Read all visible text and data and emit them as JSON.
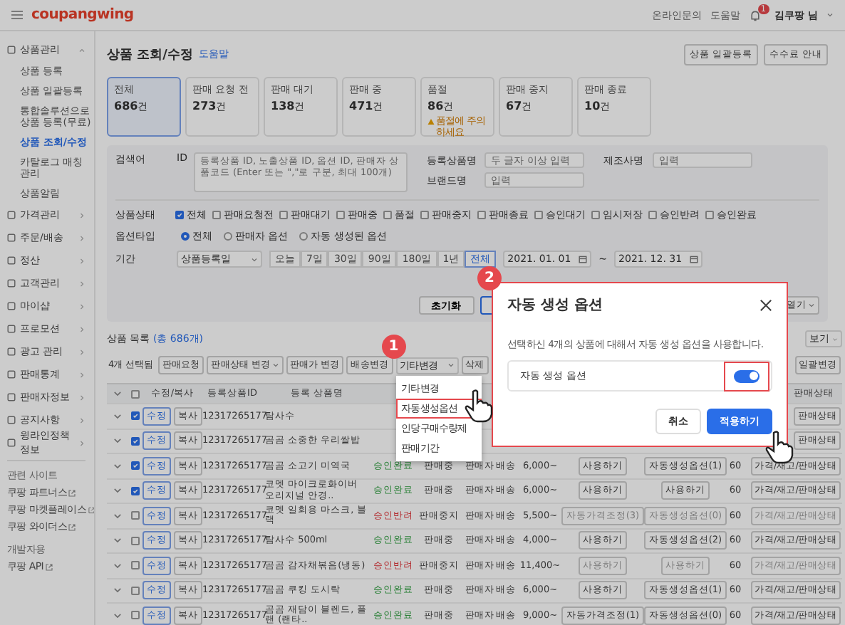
{
  "topbar": {
    "logo": "coupangwing",
    "links": [
      "온라인문의",
      "도움말"
    ],
    "notification_count": "1",
    "user": "김쿠팡 님"
  },
  "sidebar": {
    "groups": [
      {
        "label": "상품관리",
        "expanded": true,
        "children": [
          {
            "label": "상품 등록",
            "selected": false
          },
          {
            "label": "상품 일괄등록",
            "selected": false
          },
          {
            "label": "통합솔루션으로 상품 등록(무료)",
            "selected": false
          },
          {
            "label": "상품 조회/수정",
            "selected": true
          },
          {
            "label": "카탈로그 매칭관리",
            "selected": false
          },
          {
            "label": "상품알림",
            "selected": false
          }
        ]
      },
      {
        "label": "가격관리",
        "expanded": false
      },
      {
        "label": "주문/배송",
        "expanded": false
      },
      {
        "label": "정산",
        "expanded": false
      },
      {
        "label": "고객관리",
        "expanded": false
      },
      {
        "label": "마이샵",
        "expanded": false
      },
      {
        "label": "프로모션",
        "expanded": false
      },
      {
        "label": "광고 관리",
        "expanded": false
      },
      {
        "label": "판매통계",
        "expanded": false
      },
      {
        "label": "판매자정보",
        "expanded": false
      },
      {
        "label": "공지사항",
        "expanded": false
      },
      {
        "label": "윙라인정책정보",
        "expanded": false
      }
    ],
    "related_title": "관련 사이트",
    "related": [
      "쿠팡 파트너스",
      "쿠팡 마켓플레이스",
      "쿠팡 와이더스"
    ],
    "dev_title": "개발자용",
    "dev": [
      "쿠팡 API"
    ]
  },
  "page": {
    "title": "상품 조회/수정",
    "help": "도움말",
    "actions": [
      "상품 일괄등록",
      "수수료 안내"
    ]
  },
  "stats": [
    {
      "label": "전체",
      "value": "686",
      "unit": "건",
      "selected": true
    },
    {
      "label": "판매 요청 전",
      "value": "273",
      "unit": "건",
      "selected": false
    },
    {
      "label": "판매 대기",
      "value": "138",
      "unit": "건",
      "selected": false
    },
    {
      "label": "판매 중",
      "value": "471",
      "unit": "건",
      "selected": false
    },
    {
      "label": "품절",
      "value": "86",
      "unit": "건",
      "selected": false,
      "warning": "품절에 주의하세요"
    },
    {
      "label": "판매 중지",
      "value": "67",
      "unit": "건",
      "selected": false
    },
    {
      "label": "판매 종료",
      "value": "10",
      "unit": "건",
      "selected": false
    }
  ],
  "filters": {
    "keyword_label": "검색어",
    "id_label": "ID",
    "id_placeholder": "등록상품 ID, 노출상품 ID, 옵션 ID, 판매자 상품코드 (Enter 또는 \",\"로 구분, 최대 100개)",
    "name_label": "등록상품명",
    "name_placeholder": "두 글자 이상 입력",
    "maker_label": "제조사명",
    "maker_placeholder": "입력",
    "brand_label": "브랜드명",
    "brand_placeholder": "입력",
    "status_label": "상품상태",
    "statuses": [
      {
        "label": "전체",
        "checked": true
      },
      {
        "label": "판매요청전",
        "checked": false
      },
      {
        "label": "판매대기",
        "checked": false
      },
      {
        "label": "판매중",
        "checked": false
      },
      {
        "label": "품절",
        "checked": false
      },
      {
        "label": "판매중지",
        "checked": false
      },
      {
        "label": "판매종료",
        "checked": false
      },
      {
        "label": "승인대기",
        "checked": false
      },
      {
        "label": "임시저장",
        "checked": false
      },
      {
        "label": "승인반려",
        "checked": false
      },
      {
        "label": "승인완료",
        "checked": false
      }
    ],
    "option_label": "옵션타입",
    "options": [
      {
        "label": "전체",
        "selected": true
      },
      {
        "label": "판매자 옵션",
        "selected": false
      },
      {
        "label": "자동 생성된 옵션",
        "selected": false
      }
    ],
    "period_label": "기간",
    "period_type": "상품등록일",
    "periods": [
      {
        "label": "오늘",
        "selected": false
      },
      {
        "label": "7일",
        "selected": false
      },
      {
        "label": "30일",
        "selected": false
      },
      {
        "label": "90일",
        "selected": false
      },
      {
        "label": "180일",
        "selected": false
      },
      {
        "label": "1년",
        "selected": false
      },
      {
        "label": "전체",
        "selected": true
      }
    ],
    "date_from": "2021. 01. 01",
    "date_separator": "~",
    "date_to": "2021. 12. 31",
    "reset": "초기화",
    "more": "열기"
  },
  "list": {
    "title": "상품 목록",
    "count": "(총 686개)",
    "page_size": "보기",
    "selected_count": "4개 선택됨",
    "tools": [
      "판매요청",
      "판매상태 변경",
      "판매가 변경",
      "배송변경",
      "기타변경",
      "삭제"
    ],
    "bulk": "일괄변경"
  },
  "menu": {
    "items": [
      {
        "label": "기타변경",
        "highlighted": false
      },
      {
        "label": "자동생성옵션",
        "highlighted": true
      },
      {
        "label": "인당구매수량제",
        "highlighted": false
      },
      {
        "label": "판매기간",
        "highlighted": false
      }
    ]
  },
  "table": {
    "all_checked": false,
    "columns_left": [
      "수정/복사",
      "등록상품ID",
      "등록 상품명"
    ],
    "column_right": "판매상태",
    "rows": [
      {
        "checked": true,
        "edit": "수정",
        "copy": "복사",
        "id": "12317265177",
        "name": "탐사수",
        "stock_btn": "판매상태",
        "disabled": false
      },
      {
        "checked": true,
        "edit": "수정",
        "copy": "복사",
        "id": "12317265177",
        "name": "곰곰 소중한 우리쌀밥",
        "stock_btn": "판매상태",
        "disabled": false
      },
      {
        "checked": true,
        "edit": "수정",
        "copy": "복사",
        "id": "12317265177",
        "name": "곰곰 소고기 미역국",
        "approval": "승인완료",
        "approved": true,
        "sale": "판매중",
        "delivery": "판매자 배송",
        "fee": "6,000~",
        "price_btn": "사용하기",
        "option_btn": "자동생성옵션(1)",
        "limit": "60",
        "stock_btn": "가격/재고/판매상태",
        "disabled": false
      },
      {
        "checked": true,
        "edit": "수정",
        "copy": "복사",
        "id": "12317265177",
        "name": "코멧 마이크로화이버 오리지널 안경..",
        "approval": "승인완료",
        "approved": true,
        "sale": "판매중",
        "delivery": "판매자 배송",
        "fee": "6,000~",
        "price_btn": "사용하기",
        "option_btn": "사용하기",
        "limit": "60",
        "stock_btn": "가격/재고/판매상태",
        "disabled": false
      },
      {
        "checked": false,
        "edit": "수정",
        "copy": "복사",
        "id": "12317265177",
        "name": "코멧 일회용 마스크, 블랙",
        "approval": "승인반려",
        "approved": false,
        "sale": "판매중지",
        "delivery": "판매자 배송",
        "fee": "5,500~",
        "price_btn": "자동가격조정(3)",
        "option_btn": "자동생성옵션(0)",
        "limit": "60",
        "stock_btn": "가격/재고/판매상태",
        "disabled": true
      },
      {
        "checked": false,
        "edit": "수정",
        "copy": "복사",
        "id": "12317265177",
        "name": "탐사수 500ml",
        "approval": "승인완료",
        "approved": true,
        "sale": "판매중",
        "delivery": "판매자 배송",
        "fee": "4,000~",
        "price_btn": "사용하기",
        "option_btn": "자동생성옵션(2)",
        "limit": "60",
        "stock_btn": "가격/재고/판매상태",
        "disabled": false
      },
      {
        "checked": false,
        "edit": "수정",
        "copy": "복사",
        "id": "12317265177",
        "name": "곰곰 감자채볶음(냉동)",
        "approval": "승인반려",
        "approved": false,
        "sale": "판매중지",
        "delivery": "판매자 배송",
        "fee": "11,400~",
        "price_btn": "사용하기",
        "option_btn": "사용하기",
        "limit": "60",
        "stock_btn": "가격/재고/판매상태",
        "disabled": true
      },
      {
        "checked": false,
        "edit": "수정",
        "copy": "복사",
        "id": "12317265177",
        "name": "곰곰 쿠킹 도시락",
        "approval": "승인완료",
        "approved": true,
        "sale": "판매중",
        "delivery": "판매자 배송",
        "fee": "6,000~",
        "price_btn": "사용하기",
        "option_btn": "자동생성옵션(1)",
        "limit": "60",
        "stock_btn": "가격/재고/판매상태",
        "disabled": false
      },
      {
        "checked": false,
        "edit": "수정",
        "copy": "복사",
        "id": "12317265177",
        "name": "곰곰 재담이 블렌드, 플랜 (랜타..",
        "approval": "승인완료",
        "approved": true,
        "sale": "판매중",
        "delivery": "판매자 배송",
        "fee": "9,000~",
        "price_btn": "자동가격조정(1)",
        "option_btn": "자동생성옵션(0)",
        "limit": "60",
        "stock_btn": "가격/재고/판매상태",
        "disabled": false
      }
    ]
  },
  "dialog": {
    "title": "자동 생성 옵션",
    "message": "선택하신 4개의 상품에 대해서 자동 생성 옵션을 사용합니다.",
    "option_label": "자동 생성 옵션",
    "on": true,
    "cancel": "취소",
    "apply": "적용하기"
  },
  "steps": [
    "1",
    "2"
  ]
}
